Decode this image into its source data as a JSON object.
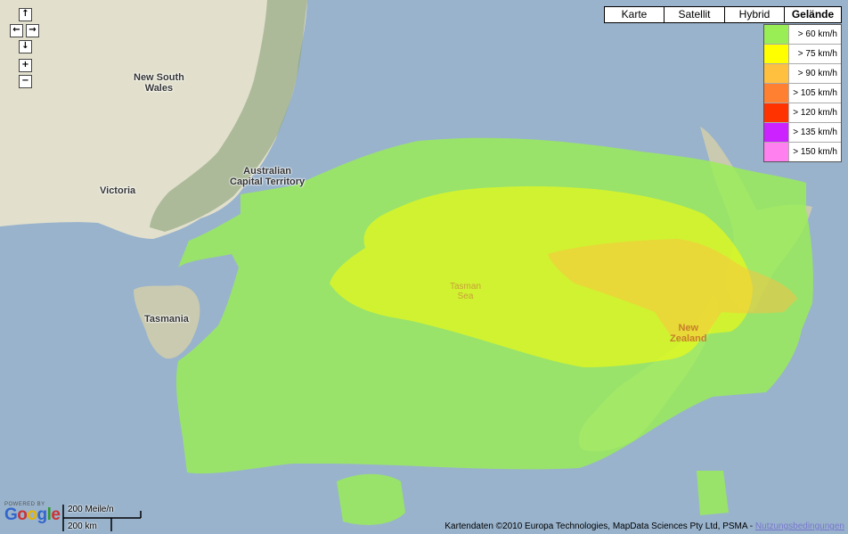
{
  "map_types": [
    {
      "label": "Karte",
      "active": false
    },
    {
      "label": "Satellit",
      "active": false
    },
    {
      "label": "Hybrid",
      "active": false
    },
    {
      "label": "Gelände",
      "active": true
    }
  ],
  "legend": [
    {
      "label": "> 60 km/h",
      "color": "#99ee55"
    },
    {
      "label": "> 75 km/h",
      "color": "#ffff00"
    },
    {
      "label": "> 90 km/h",
      "color": "#ffc040"
    },
    {
      "label": "> 105 km/h",
      "color": "#ff8030"
    },
    {
      "label": "> 120 km/h",
      "color": "#ff3300"
    },
    {
      "label": "> 135 km/h",
      "color": "#cc22ff"
    },
    {
      "label": "> 150 km/h",
      "color": "#ff80ee"
    }
  ],
  "nav": {
    "up": "↑",
    "left": "←",
    "right": "→",
    "down": "↓",
    "zoom_in": "+",
    "zoom_out": "−"
  },
  "labels": {
    "nsw_line1": "New South",
    "nsw_line2": "Wales",
    "act_line1": "Australian",
    "act_line2": "Capital Territory",
    "victoria": "Victoria",
    "tasmania": "Tasmania",
    "tasman_line1": "Tasman",
    "tasman_line2": "Sea",
    "nz_line1": "New",
    "nz_line2": "Zealand"
  },
  "branding": {
    "powered_by": "POWERED BY",
    "google": "Google"
  },
  "scale": {
    "miles": "200 Meile/n",
    "km": "200 km"
  },
  "attribution": {
    "text": "Kartendaten ©2010 Europa Technologies, MapData Sciences Pty Ltd, PSMA - ",
    "link": "Nutzungsbedingungen"
  }
}
